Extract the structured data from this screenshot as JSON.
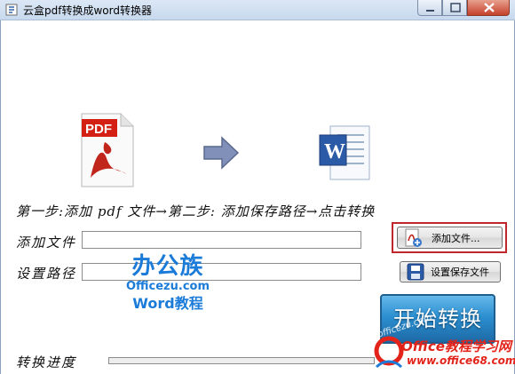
{
  "window": {
    "title": "云盒pdf转换成word转换器"
  },
  "icons": {
    "pdf_label": "PDF",
    "word_label": "W"
  },
  "steps_text": "第一步:添加 pdf 文件→第二步: 添加保存路径→点击转换",
  "form": {
    "add_file_label": "添加文件",
    "add_file_value": "",
    "set_path_label": "设置路径",
    "set_path_value": ""
  },
  "buttons": {
    "add_file": "添加文件...",
    "set_save_file": "设置保存文件",
    "start_convert": "开始转换"
  },
  "progress": {
    "label": "转换进度",
    "value": 0
  },
  "watermarks": {
    "brand_cn": "办公族",
    "brand_url": "Officezu.com",
    "brand_sub": "Word教程",
    "site_title": "Office教程学习网",
    "site_url": "www.office68.com",
    "start_overlay": "officezu.com"
  },
  "colors": {
    "accent_blue": "#2c8fd0",
    "highlight_red": "#c0272d",
    "watermark_blue": "#1b7bd8",
    "watermark_red": "#e2231a"
  }
}
